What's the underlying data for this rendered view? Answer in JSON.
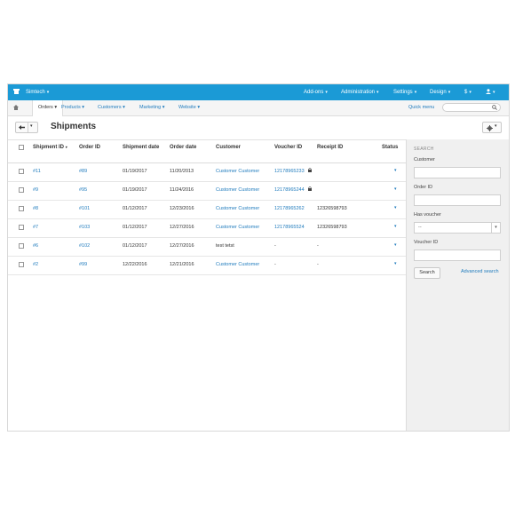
{
  "topbar": {
    "store_name": "Simtech",
    "menu": [
      "Add-ons",
      "Administration",
      "Settings",
      "Design",
      "$"
    ]
  },
  "navbar": {
    "items": [
      "Orders",
      "Products",
      "Customers",
      "Marketing",
      "Website"
    ],
    "quick_menu": "Quick menu",
    "quick_search_placeholder": ""
  },
  "header": {
    "title": "Shipments"
  },
  "table": {
    "columns": [
      "Shipment ID",
      "Order ID",
      "Shipment date",
      "Order date",
      "Customer",
      "Voucher ID",
      "Receipt ID",
      "Status"
    ],
    "rows": [
      {
        "shipment_id": "#11",
        "order_id": "#89",
        "shipment_date": "01/19/2017",
        "order_date": "11/20/2013",
        "customer": "Customer Customer",
        "voucher_id": "12178965233",
        "receipt_id": "",
        "locked": true
      },
      {
        "shipment_id": "#9",
        "order_id": "#95",
        "shipment_date": "01/19/2017",
        "order_date": "11/24/2016",
        "customer": "Customer Customer",
        "voucher_id": "12178965244",
        "receipt_id": "",
        "locked": true
      },
      {
        "shipment_id": "#8",
        "order_id": "#101",
        "shipment_date": "01/12/2017",
        "order_date": "12/23/2016",
        "customer": "Customer Customer",
        "voucher_id": "12178965262",
        "receipt_id": "12326598793",
        "locked": false
      },
      {
        "shipment_id": "#7",
        "order_id": "#103",
        "shipment_date": "01/12/2017",
        "order_date": "12/27/2016",
        "customer": "Customer Customer",
        "voucher_id": "12178965524",
        "receipt_id": "12326598793",
        "locked": false
      },
      {
        "shipment_id": "#6",
        "order_id": "#102",
        "shipment_date": "01/12/2017",
        "order_date": "12/27/2016",
        "customer": "test tetst",
        "voucher_id": "-",
        "receipt_id": "-",
        "locked": false
      },
      {
        "shipment_id": "#2",
        "order_id": "#99",
        "shipment_date": "12/22/2016",
        "order_date": "12/21/2016",
        "customer": "Customer Customer",
        "voucher_id": "-",
        "receipt_id": "-",
        "locked": false
      }
    ]
  },
  "sidebar": {
    "title": "SEARCH",
    "customer_label": "Customer",
    "order_id_label": "Order ID",
    "has_voucher_label": "Has voucher",
    "has_voucher_value": "--",
    "voucher_id_label": "Voucher ID",
    "search_button": "Search",
    "advanced_search": "Advanced search"
  },
  "colors": {
    "topbar": "#1b9ad6",
    "link": "#1f7bbd"
  }
}
